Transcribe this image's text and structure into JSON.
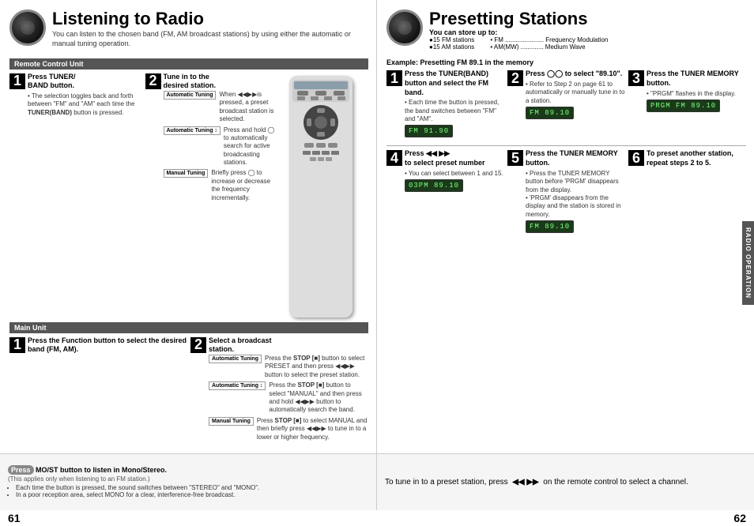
{
  "left": {
    "title": "Listening to Radio",
    "subtitle": "You can listen to the chosen band (FM, AM broadcast stations) by using either\nthe automatic or manual tuning operation.",
    "remote_section_label": "Remote Control Unit",
    "main_unit_label": "Main Unit",
    "step1": {
      "number": "1",
      "title": "Press TUNER/\nBAND button.",
      "detail": "• The selection toggles back and forth between \"FM\" and \"AM\" each time the TUNER(BAND) button is pressed."
    },
    "step2": {
      "number": "2",
      "title": "Tune in to the\ndesired station."
    },
    "tuning": [
      {
        "label": "Automatic Tuning",
        "text": "When ◀◀▶▶ is pressed, a preset broadcast station is selected."
      },
      {
        "label": "Automatic Tuning",
        "text": "Press and hold ◯ to automatically search for active broadcasting stations."
      },
      {
        "label": "Manual Tuning",
        "text": "Briefly press ◯ to increase or decrease the frequency incrementally."
      }
    ],
    "main_step1": {
      "number": "1",
      "title": "Press the Function button to select the desired band (FM, AM)."
    },
    "main_step2": {
      "number": "2",
      "title": "Select a broadcast station."
    },
    "main_tuning": [
      {
        "label": "Automatic Tuning",
        "text": "Press the STOP [■] button to select PRESET and then press ◀◀▶▶ button to select the preset station."
      },
      {
        "label": "Automatic Tuning",
        "text": "Press the STOP [■] button to select \"MANUAL\" and then press and hold ◀◀▶▶ button to automatically search the band."
      },
      {
        "label": "Manual Tuning",
        "text": "Press STOP [■] to select MANUAL and then briefly press ◀◀▶▶ to tune in to a lower or higher frequency."
      }
    ]
  },
  "right": {
    "title": "Presetting Stations",
    "store_title": "You can store up to:",
    "store_items": [
      {
        "bullet": "●15 FM stations",
        "detail": "• FM ...................... Frequency Modulation"
      },
      {
        "bullet": "●15 AM stations",
        "detail": "• AM(MW) ............. Medium Wave"
      }
    ],
    "example_label": "Example: Presetting FM 89.1 in the memory",
    "step1": {
      "number": "1",
      "title": "Press the TUNER(BAND) button and select the FM band.",
      "detail": "• Each time the button is pressed, the band switches between \"FM\" and \"AM\".",
      "display": "FM  91.90"
    },
    "step2": {
      "number": "2",
      "title": "Press ◯◯ to select \"89.10\".",
      "detail": "• Refer to Step 2 on page 61 to automatically or manually tune in to a station.",
      "display": "FM  89.10"
    },
    "step3": {
      "number": "3",
      "title": "Press the TUNER MEMORY button.",
      "detail": "• \"PRGM\" flashes in the display.",
      "display": "PRGM FM  89.10"
    },
    "step4": {
      "number": "4",
      "title": "Press ◀◀ ▶▶ to select preset number",
      "detail": "• You can select between 1 and 15.",
      "display": "03PM  89.10"
    },
    "step5": {
      "number": "5",
      "title": "Press the TUNER MEMORY button.",
      "detail": "• Press the TUNER MEMORY button before 'PRGM' disappears from the display.\n• 'PRGM' disappears from the display and the station is stored in memory.",
      "display": "FM  89.10"
    },
    "step6": {
      "number": "6",
      "title": "To preset another station, repeat steps 2 to 5."
    }
  },
  "bottom": {
    "left_title": "Press MO/ST button to listen in Mono/Stereo.",
    "left_subtitle": "(This applies only when listening to an FM station.)",
    "left_bullets": [
      "Each time the button is pressed, the sound switches between \"STEREO\" and \"MONO\".",
      "In a poor reception area, select MONO for a clear, interference-free broadcast."
    ],
    "right_text": "To tune in to a preset station, press  ◀◀ ▶▶  on the\nremote control to select a channel."
  },
  "page_left": "61",
  "page_right": "62",
  "side_tab": "RADIO OPERATION"
}
